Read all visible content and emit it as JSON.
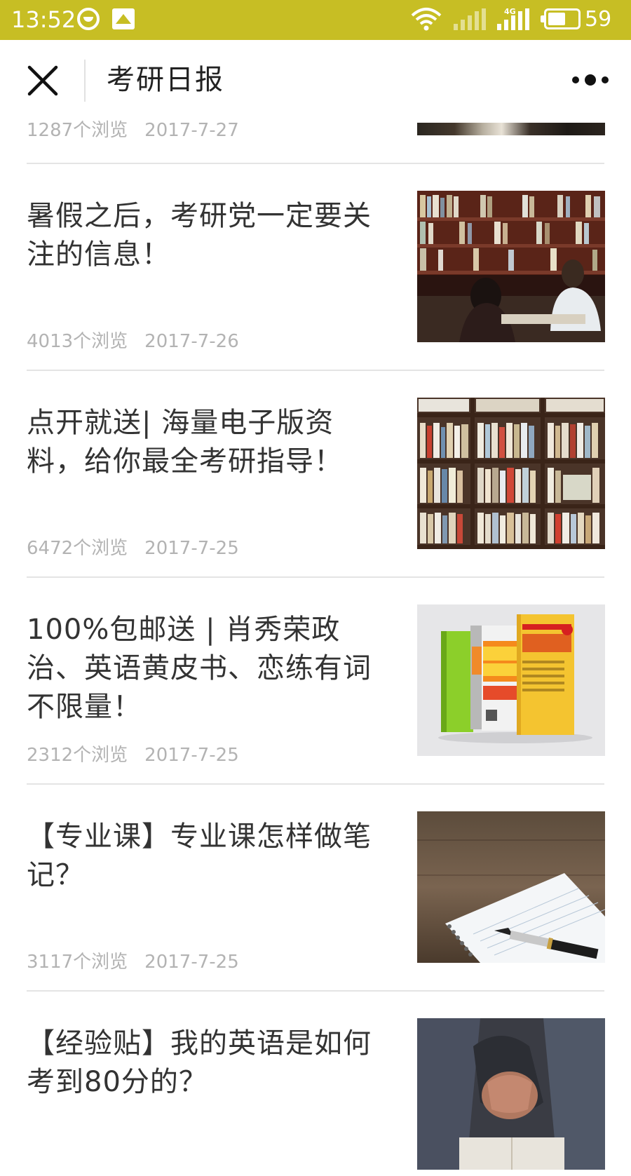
{
  "status_bar": {
    "time": "13:52",
    "network_type": "4G",
    "battery_level": "59",
    "battery_fraction": 0.59,
    "icons": [
      "emoji-icon",
      "photo-icon",
      "wifi-icon",
      "signal-icon",
      "signal-icon",
      "battery-icon"
    ],
    "background_color": "#c7be24"
  },
  "nav_bar": {
    "title": "考研日报",
    "close_icon": "close-icon",
    "more_icon": "more-icon"
  },
  "partial_item": {
    "views": "1287个浏览",
    "date": "2017-7-27"
  },
  "articles": [
    {
      "title": "暑假之后，考研党一定要关注的信息！",
      "views": "4013个浏览",
      "date": "2017-7-26",
      "thumbnail": "library-students-image"
    },
    {
      "title": "点开就送| 海量电子版资料，给你最全考研指导！",
      "views": "6472个浏览",
      "date": "2017-7-25",
      "thumbnail": "bookshelf-image"
    },
    {
      "title": "100%包邮送 | 肖秀荣政治、英语黄皮书、恋练有词不限量！",
      "views": "2312个浏览",
      "date": "2017-7-25",
      "thumbnail": "books-covers-image"
    },
    {
      "title": "【专业课】专业课怎样做笔记？",
      "views": "3117个浏览",
      "date": "2017-7-25",
      "thumbnail": "notebook-pen-image"
    },
    {
      "title": "【经验贴】我的英语是如何考到80分的？",
      "views": "",
      "date": "",
      "thumbnail": "praying-hands-image"
    }
  ]
}
